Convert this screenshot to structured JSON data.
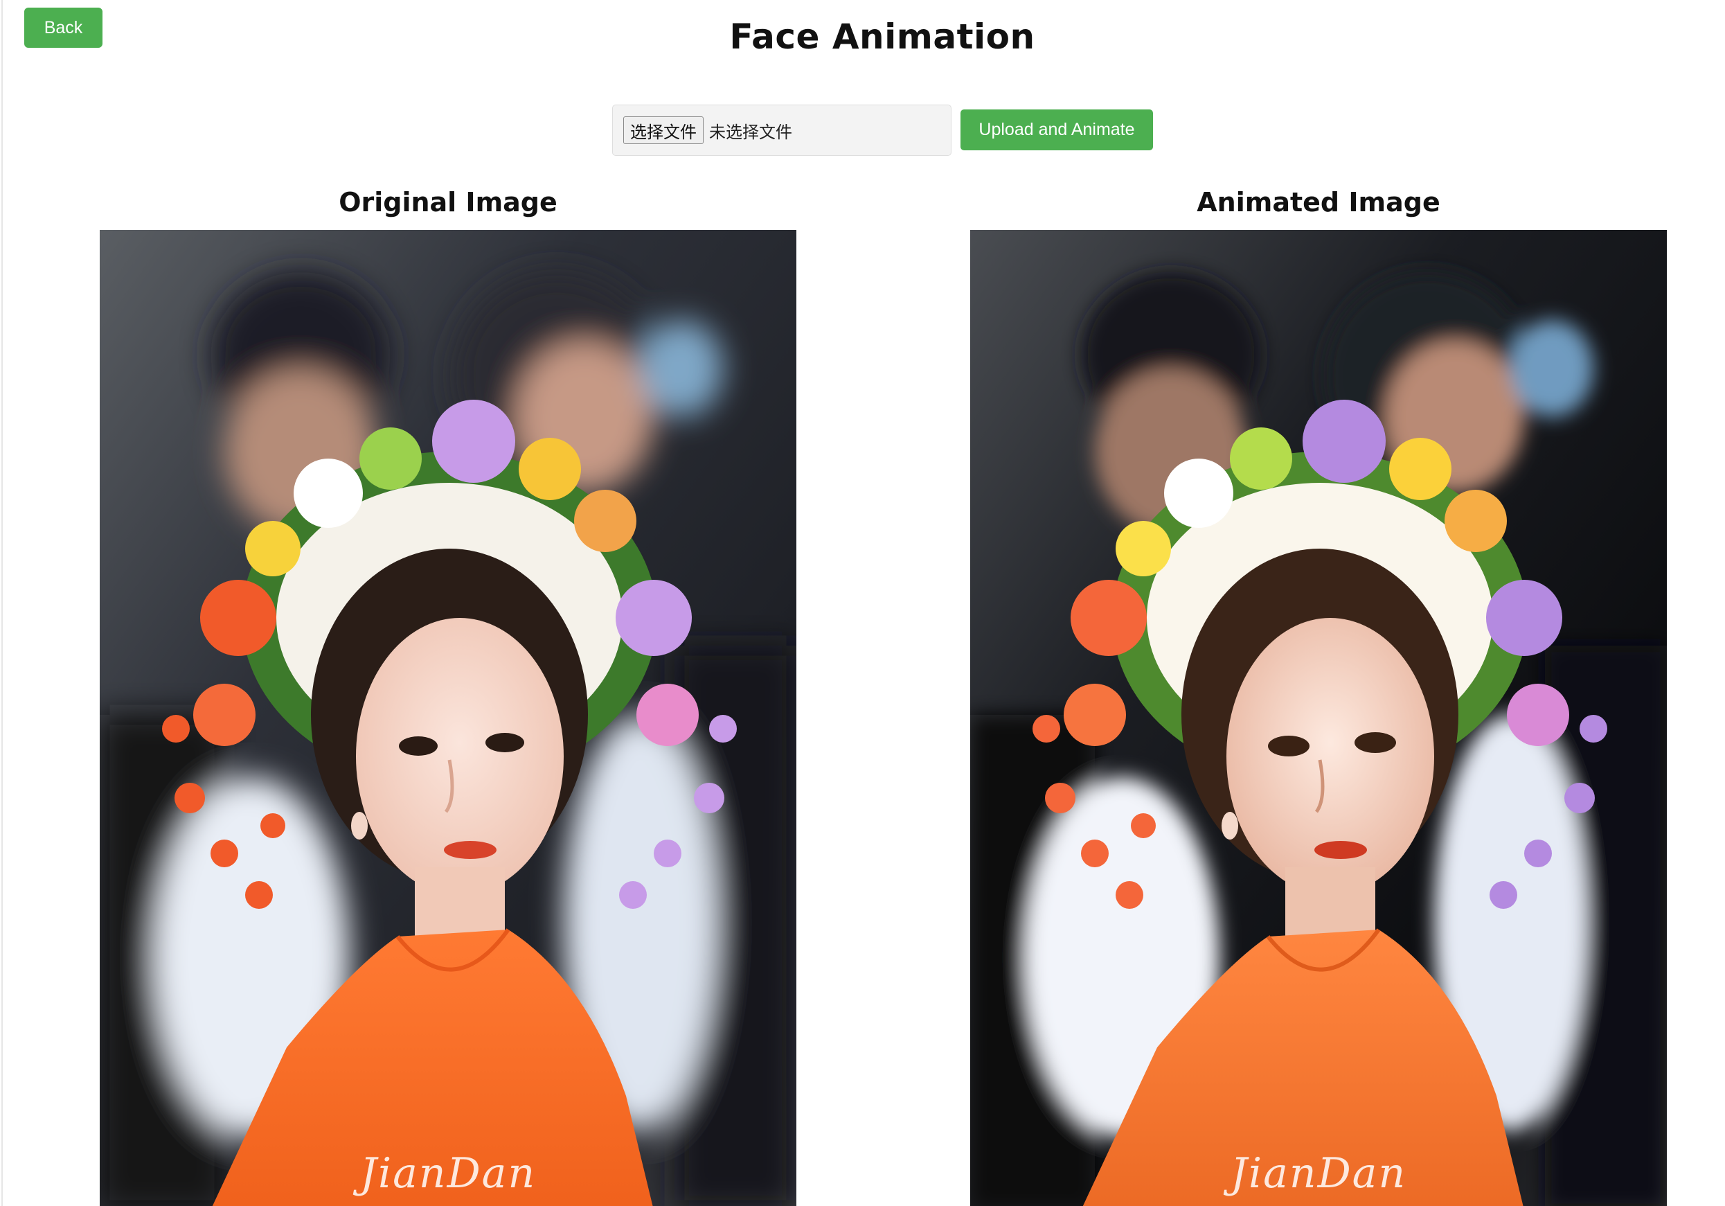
{
  "header": {
    "back_label": "Back",
    "title": "Face Animation"
  },
  "upload": {
    "choose_label": "选择文件",
    "file_status": "未选择文件",
    "submit_label": "Upload and Animate"
  },
  "panels": {
    "original": {
      "heading": "Original Image",
      "watermark": "JianDan"
    },
    "animated": {
      "heading": "Animated Image",
      "watermark": "JianDan"
    }
  },
  "colors": {
    "button_green": "#4caf50",
    "dress_orange": "#f5712a"
  }
}
